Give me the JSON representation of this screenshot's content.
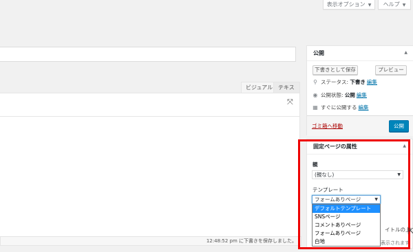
{
  "top_buttons": {
    "screen_options": "表示オプション",
    "help": "ヘルプ"
  },
  "editor": {
    "tab_visual": "ビジュアル",
    "tab_text": "テキスト",
    "status": "12:48:52 pm に下書きを保存しました。"
  },
  "publish": {
    "title": "公開",
    "save_draft": "下書きとして保存",
    "preview": "プレビュー",
    "status_label": "ステータス:",
    "status_value": "下書き",
    "visibility_label": "公開状態:",
    "visibility_value": "公開",
    "schedule_label": "すぐに公開する",
    "edit": "編集",
    "trash": "ゴミ箱へ移動",
    "publish_button": "公開"
  },
  "page_attributes": {
    "title": "固定ページの属性",
    "parent_label": "親",
    "parent_value": "(親なし)",
    "template_label": "テンプレート",
    "template_value": "フォームありページ",
    "template_options": [
      "デフォルトテンプレート",
      "SNSページ",
      "コメントありページ",
      "フォームありページ",
      "白地"
    ],
    "behind_text_1": "イトルの上",
    "behind_text_2": "に表示されます"
  },
  "colors": {
    "highlight": "#ee0000",
    "primary_button": "#0085ba",
    "link": "#0073aa",
    "trash_link": "#aa0000",
    "selected_option": "#1e90ff"
  }
}
